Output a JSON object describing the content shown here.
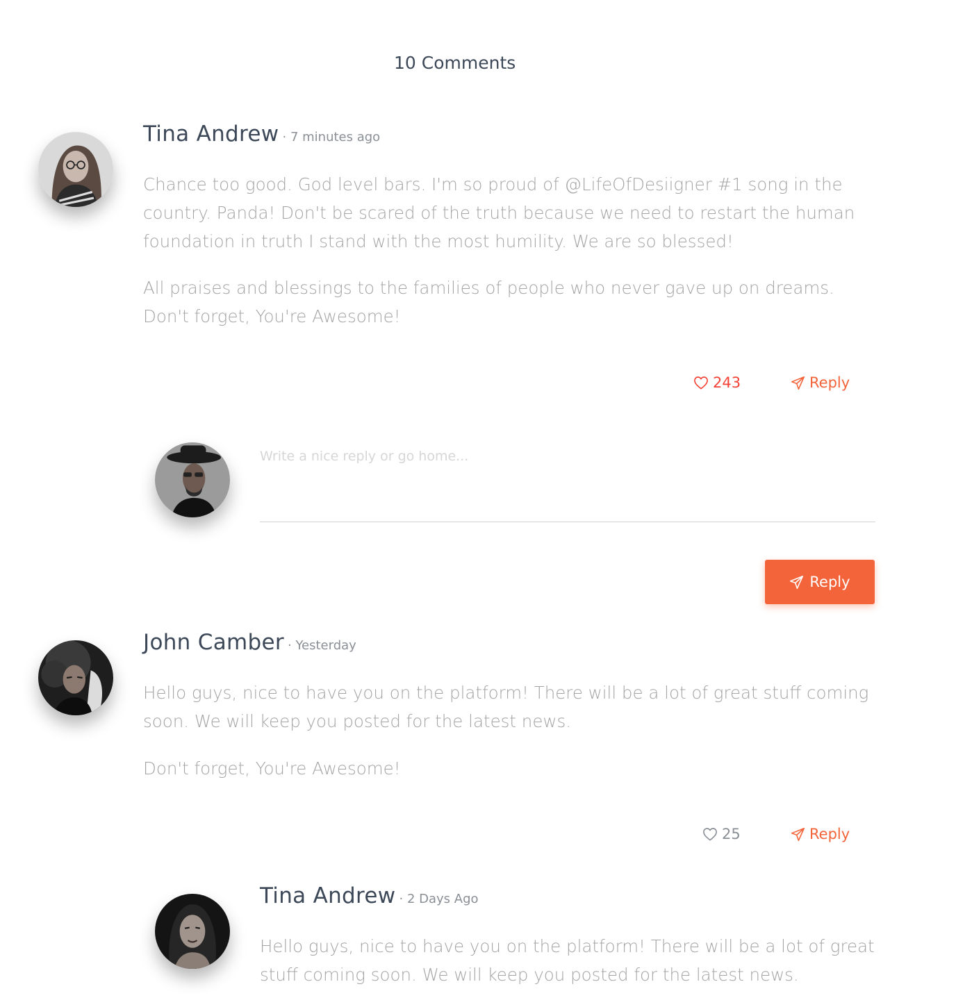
{
  "section": {
    "title": "10 Comments"
  },
  "colors": {
    "accent": "#f4643a",
    "like_active": "#f44336",
    "text_muted": "#a4a4a4"
  },
  "comments": [
    {
      "author": "Tina Andrew",
      "time": "· 7 minutes ago",
      "paragraphs": [
        "Chance too good. God level bars. I'm so proud of @LifeOfDesiigner #1 song in the country. Panda! Don't be scared of the truth because we need to restart the human foundation in truth I stand with the most humility. We are so blessed!",
        "All praises and blessings to the families of people who never gave up on dreams. Don't forget, You're Awesome!"
      ],
      "likes": "243",
      "reply_label": "Reply"
    },
    {
      "author": "John Camber",
      "time": "· Yesterday",
      "paragraphs": [
        "Hello guys, nice to have you on the platform! There will be a lot of great stuff coming soon. We will keep you posted for the latest news.",
        "Don't forget, You're Awesome!"
      ],
      "likes": "25",
      "reply_label": "Reply"
    }
  ],
  "reply_form": {
    "placeholder": "Write a nice reply or go home...",
    "value": "",
    "button_label": "Reply"
  },
  "nested_reply": {
    "author": "Tina Andrew",
    "time": "· 2 Days Ago",
    "text": "Hello guys, nice to have you on the platform! There will be a lot of great stuff coming soon. We will keep you posted for the latest news."
  },
  "icons": {
    "like": "heart-icon",
    "reply": "paper-plane-icon"
  }
}
